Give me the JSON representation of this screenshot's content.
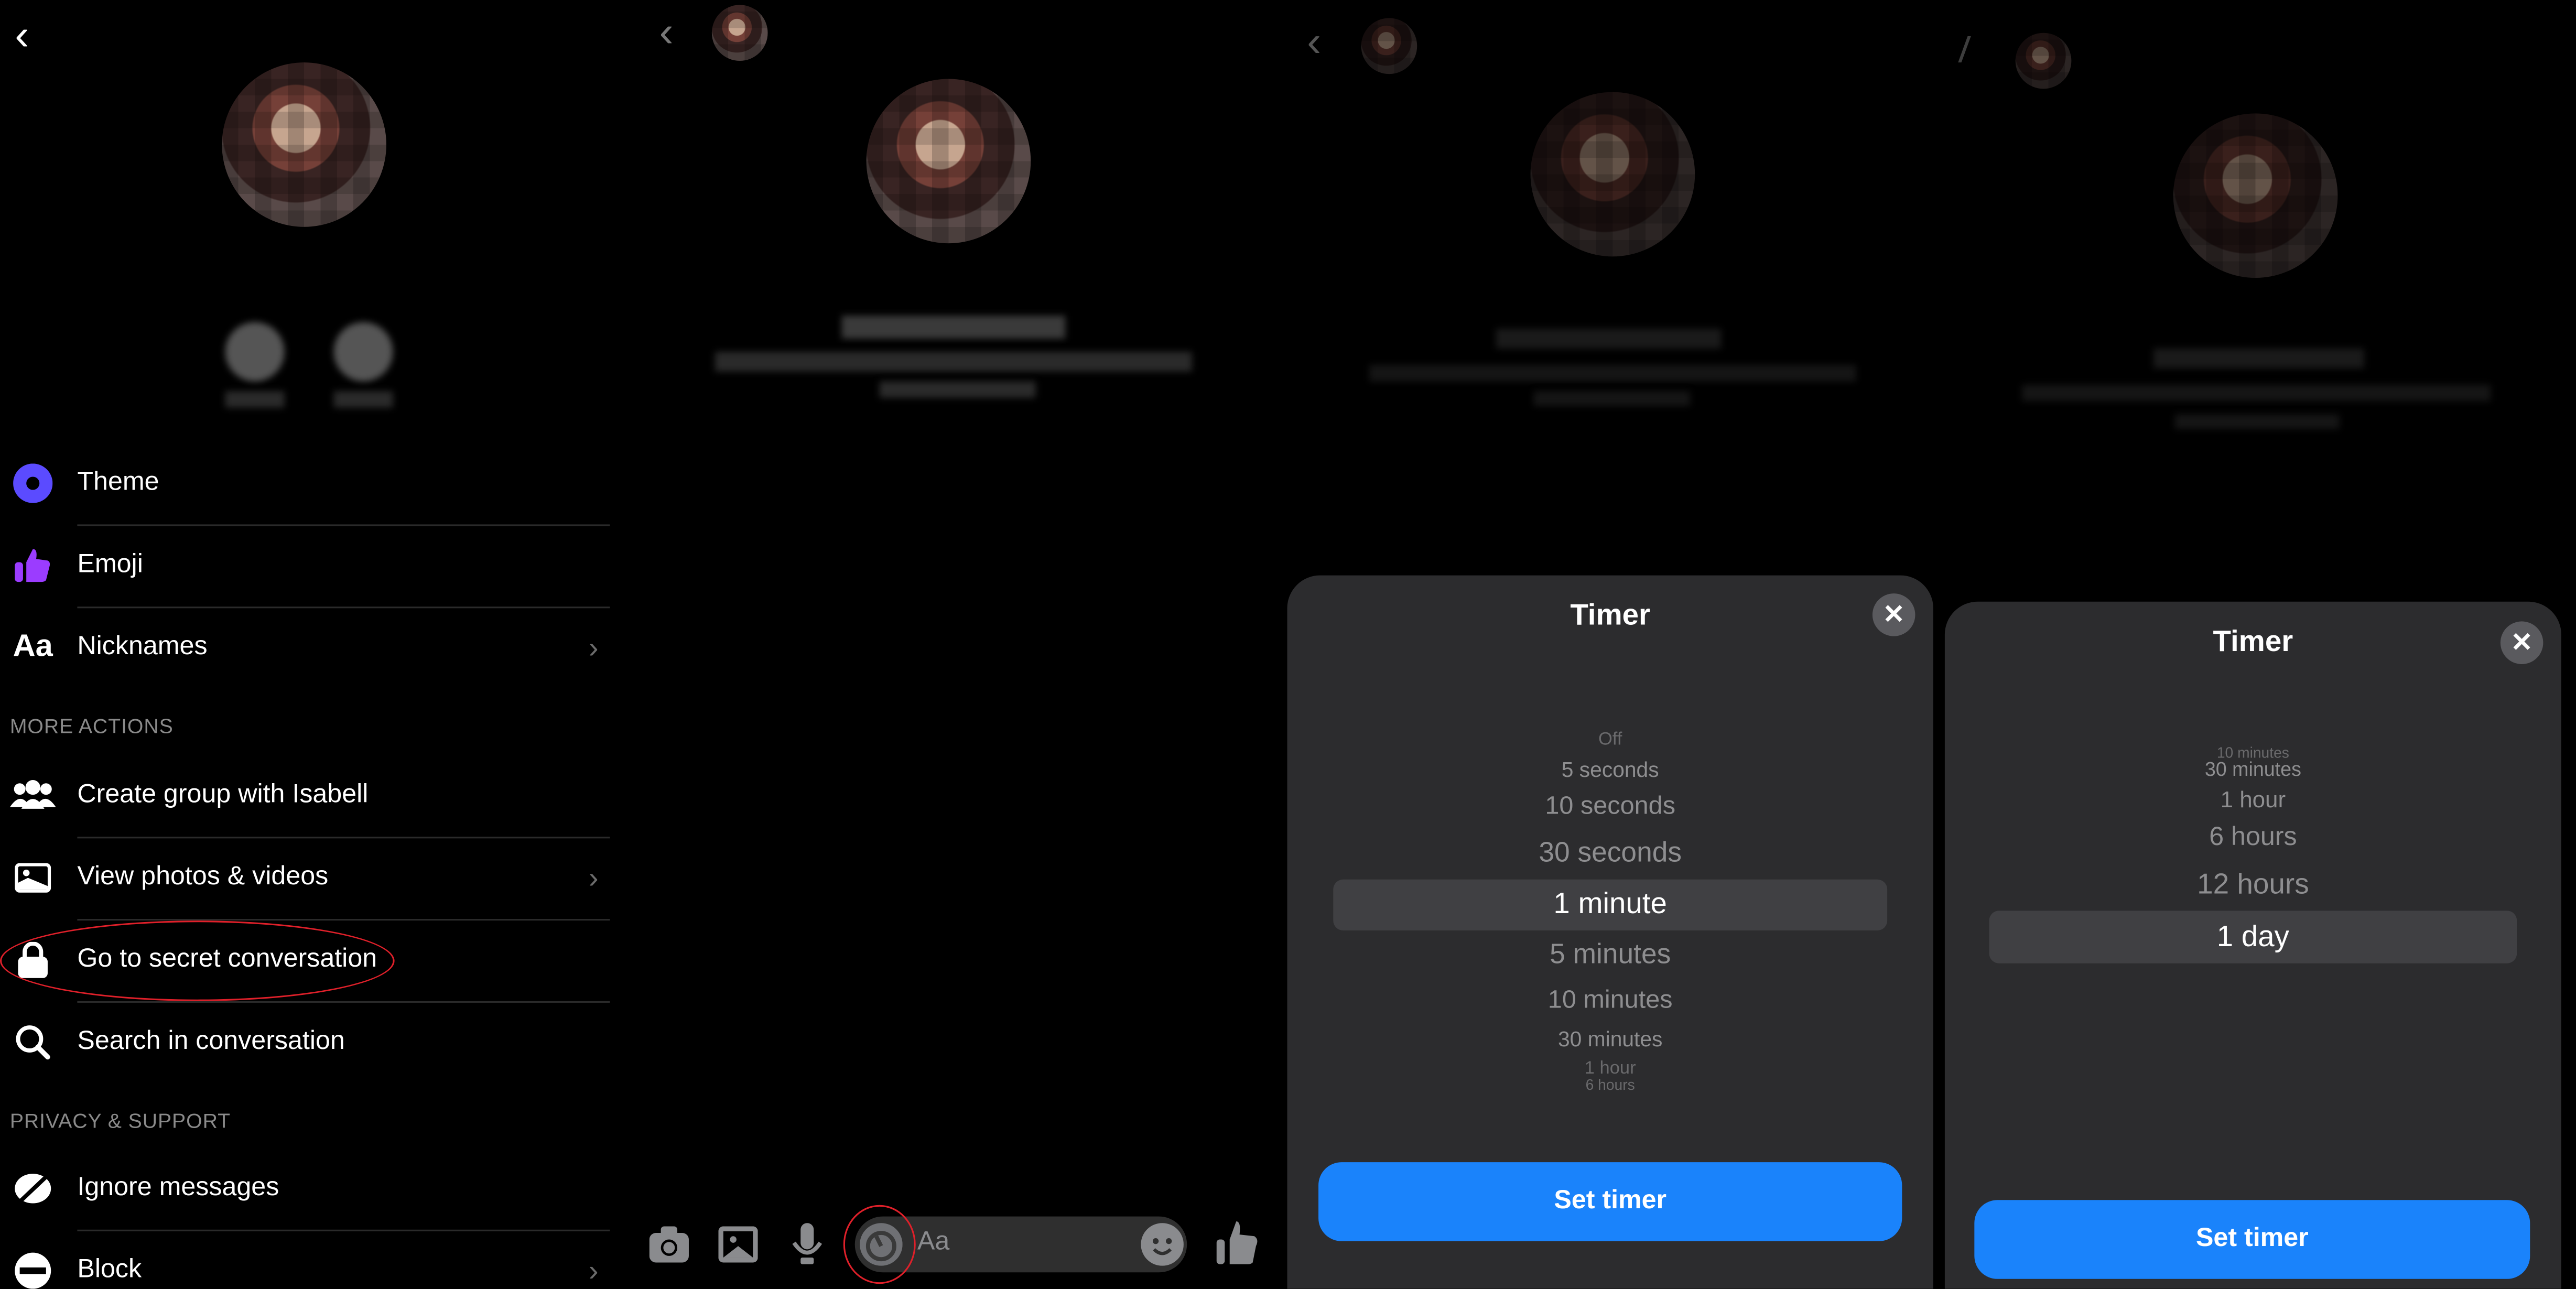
{
  "panel1": {
    "items": [
      {
        "label": "Theme",
        "icon": "theme-icon",
        "chevron": false
      },
      {
        "label": "Emoji",
        "icon": "thumbs-up-icon",
        "chevron": false
      },
      {
        "label": "Nicknames",
        "icon": "text-aa-icon",
        "chevron": true,
        "icon_text": "Aa"
      },
      {
        "label": "Create group with Isabell",
        "icon": "group-icon",
        "chevron": false
      },
      {
        "label": "View photos & videos",
        "icon": "photo-icon",
        "chevron": true
      },
      {
        "label": "Go to secret conversation",
        "icon": "lock-icon",
        "chevron": false,
        "highlighted": true
      },
      {
        "label": "Search in conversation",
        "icon": "search-icon",
        "chevron": false
      },
      {
        "label": "Ignore messages",
        "icon": "ignore-icon",
        "chevron": false
      },
      {
        "label": "Block",
        "icon": "block-icon",
        "chevron": true
      }
    ],
    "sections": {
      "more_actions": "MORE ACTIONS",
      "privacy": "PRIVACY & SUPPORT"
    },
    "colors": {
      "theme": "#5b4bff",
      "emoji": "#9b3cff",
      "annotation": "#e0202a"
    }
  },
  "panel2": {
    "composer_placeholder": "Aa",
    "icons": [
      "camera-icon",
      "image-icon",
      "microphone-icon",
      "timer-icon",
      "emoji-icon",
      "thumbs-up-icon"
    ]
  },
  "panel3": {
    "title": "Timer",
    "options": [
      "Off",
      "5 seconds",
      "10 seconds",
      "30 seconds",
      "1 minute",
      "5 minutes",
      "10 minutes",
      "30 minutes",
      "1 hour",
      "6 hours"
    ],
    "selected": "1 minute",
    "button": "Set timer"
  },
  "panel4": {
    "title": "Timer",
    "options": [
      "10 minutes",
      "30 minutes",
      "1 hour",
      "6 hours",
      "12 hours",
      "1 day"
    ],
    "selected": "1 day",
    "button": "Set timer"
  },
  "colors": {
    "accent": "#1a83fb",
    "sheet": "#2c2c2e",
    "highlight": "#404043"
  }
}
